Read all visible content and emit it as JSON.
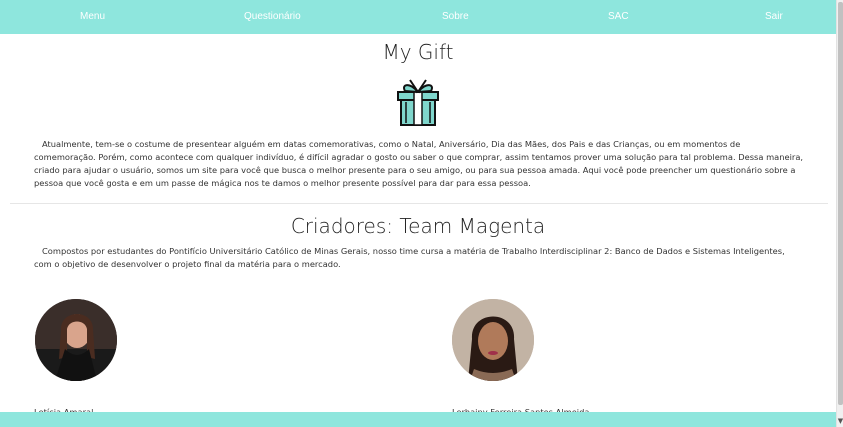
{
  "nav": {
    "items": [
      {
        "label": "Menu"
      },
      {
        "label": "Questionário"
      },
      {
        "label": "Sobre"
      },
      {
        "label": "SAC"
      },
      {
        "label": "Sair"
      }
    ]
  },
  "main": {
    "title": "My Gift",
    "intro": "Atualmente, tem-se o costume de presentear alguém em datas comemorativas, como o Natal, Aniversário, Dia das Mães, dos Pais e das Crianças, ou em momentos de comemoração. Porém, como acontece com qualquer indivíduo, é difícil agradar o gosto ou saber o que comprar, assim tentamos prover uma solução para tal problema.      Dessa maneira, criado para ajudar o usuário, somos um site para você que busca o melhor presente para o seu amigo, ou para sua pessoa amada. Aqui você pode preencher um questionário sobre a pessoa que você gosta e em um passe de mágica nos te damos o melhor presente possível para dar para essa pessoa."
  },
  "creators": {
    "title": "Criadores: Team Magenta",
    "description": "Compostos por estudantes do Pontifício Universitário Católico de Minas Gerais, nosso time cursa a matéria de Trabalho Interdisciplinar 2: Banco de Dados e Sistemas Inteligentes, com o objetivo de desenvolver o projeto final da matéria para o mercado.",
    "members": [
      {
        "name": "Letícia Amaral"
      },
      {
        "name": "Lorhainy Ferreira Santos Almeida"
      }
    ]
  },
  "colors": {
    "accent": "#8ee6dd",
    "gift_teal": "#7fd6cc"
  },
  "icons": {
    "logo": "gift-box-icon"
  }
}
